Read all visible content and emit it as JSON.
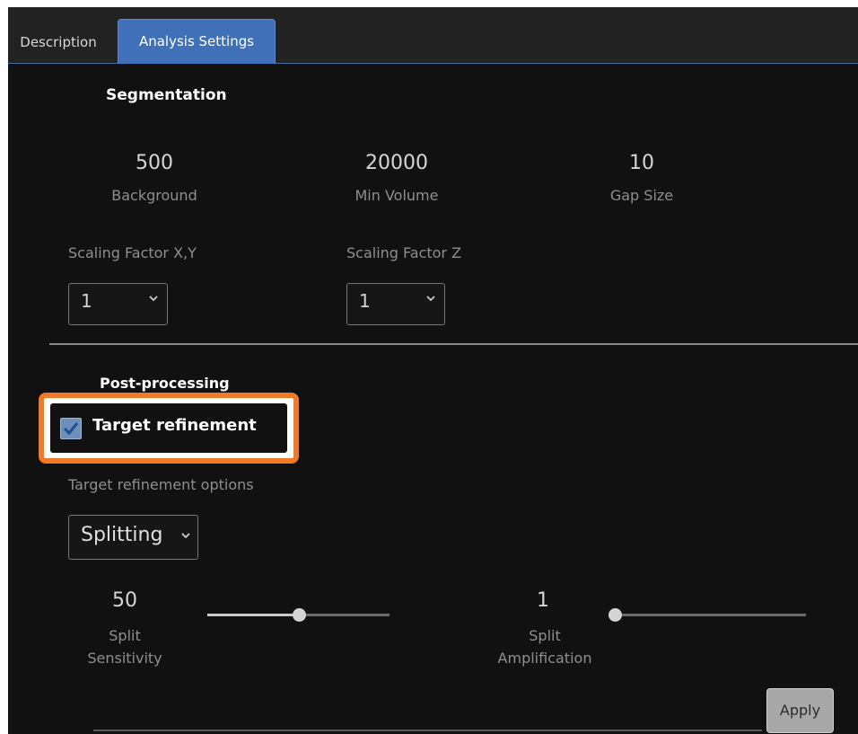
{
  "tabs": [
    {
      "label": "Description",
      "active": false
    },
    {
      "label": "Analysis Settings",
      "active": true
    }
  ],
  "segmentation": {
    "title": "Segmentation",
    "stats": [
      {
        "value": "500",
        "label": "Background"
      },
      {
        "value": "20000",
        "label": "Min Volume"
      },
      {
        "value": "10",
        "label": "Gap Size"
      }
    ],
    "scaling_xy": {
      "label": "Scaling Factor X,Y",
      "value": "1"
    },
    "scaling_z": {
      "label": "Scaling Factor Z",
      "value": "1"
    }
  },
  "post_processing": {
    "title": "Post-processing",
    "target_refinement": {
      "label": "Target refinement",
      "checked": true
    },
    "options_label": "Target refinement options",
    "options_value": "Splitting",
    "sliders": [
      {
        "value": "50",
        "label_line1": "Split",
        "label_line2": "Sensitivity",
        "fraction": 0.5
      },
      {
        "value": "1",
        "label_line1": "Split",
        "label_line2": "Amplification",
        "fraction": 0.0
      }
    ]
  },
  "apply_label": "Apply",
  "colors": {
    "accent_tab": "#3f70b8",
    "highlight": "#f07a25",
    "checkbox": "#6d8fb8"
  }
}
